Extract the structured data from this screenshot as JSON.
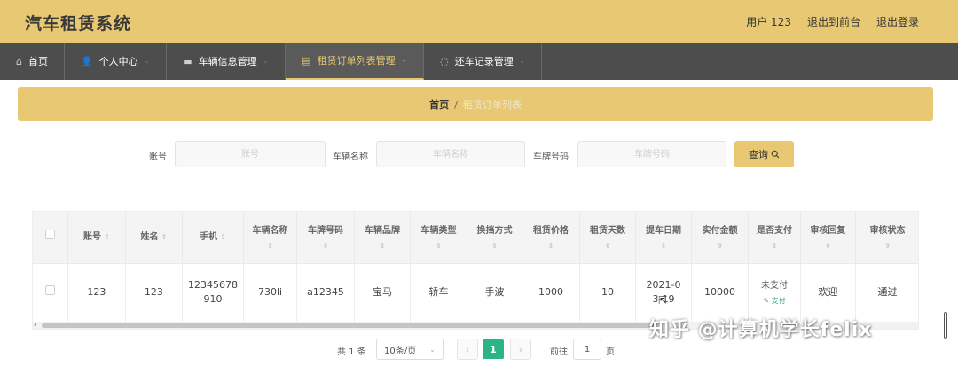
{
  "app": {
    "title": "汽车租赁系统"
  },
  "topbar": {
    "user": "用户 123",
    "back_front": "退出到前台",
    "logout": "退出登录"
  },
  "nav": {
    "items": [
      {
        "label": "首页",
        "icon": "home-icon",
        "glyph": "⌂",
        "chevron": ""
      },
      {
        "label": "个人中心",
        "icon": "user-icon",
        "glyph": "👤",
        "chevron": "⌄"
      },
      {
        "label": "车辆信息管理",
        "icon": "car-icon",
        "glyph": "▬",
        "chevron": "⌄"
      },
      {
        "label": "租赁订单列表管理",
        "icon": "list-icon",
        "glyph": "▤",
        "chevron": "⌄",
        "active": true
      },
      {
        "label": "还车记录管理",
        "icon": "record-icon",
        "glyph": "◌",
        "chevron": "⌄"
      }
    ]
  },
  "breadcrumb": {
    "home": "首页",
    "separator": "/",
    "current": "租赁订单列表"
  },
  "search": {
    "account_label": "账号",
    "account_placeholder": "账号",
    "car_name_label": "车辆名称",
    "car_name_placeholder": "车辆名称",
    "plate_label": "车牌号码",
    "plate_placeholder": "车牌号码",
    "button_label": "查询",
    "button_icon": "search-icon"
  },
  "table": {
    "sort_glyph": "⇕",
    "headers": [
      "账号",
      "姓名",
      "手机",
      "车辆名称",
      "车牌号码",
      "车辆品牌",
      "车辆类型",
      "换挡方式",
      "租赁价格",
      "租赁天数",
      "提车日期",
      "实付金额",
      "是否支付",
      "审核回复",
      "审核状态"
    ],
    "rows": [
      {
        "account": "123",
        "name": "123",
        "phone": "12345678910",
        "car_name": "730li",
        "plate": "a12345",
        "brand": "宝马",
        "type": "轿车",
        "gear": "手波",
        "price": "1000",
        "days": "10",
        "pickup_date": "2021-03-19",
        "paid_amount": "10000",
        "pay_status": "未支付",
        "pay_action": "支付",
        "review_reply": "欢迎",
        "review_status": "通过"
      }
    ]
  },
  "pagination": {
    "total": "共 1 条",
    "page_size": "10条/页",
    "prev": "‹",
    "current_page": "1",
    "next": "›",
    "goto_label": "前往",
    "goto_value": "1",
    "page_unit": "页"
  },
  "watermark": {
    "text": "知乎 @计算机学长felix"
  },
  "colors": {
    "accent": "#e8c873",
    "nav_bg": "#4d4d4d",
    "page_active": "#2bb486",
    "pay_link": "#3bb37a"
  }
}
